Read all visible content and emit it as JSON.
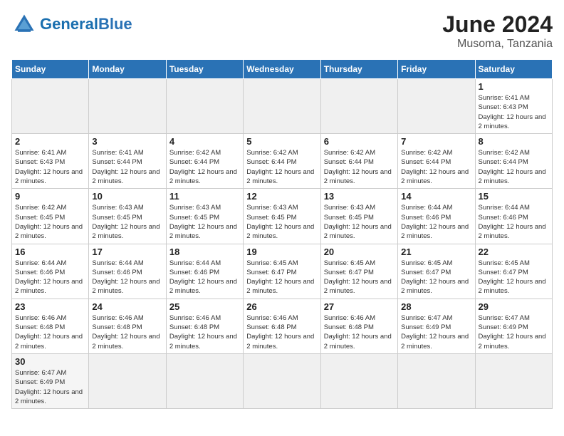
{
  "header": {
    "logo_text_normal": "General",
    "logo_text_blue": "Blue",
    "title": "June 2024",
    "subtitle": "Musoma, Tanzania"
  },
  "calendar": {
    "days_of_week": [
      "Sunday",
      "Monday",
      "Tuesday",
      "Wednesday",
      "Thursday",
      "Friday",
      "Saturday"
    ],
    "weeks": [
      [
        {
          "day": "",
          "info": "",
          "empty": true
        },
        {
          "day": "",
          "info": "",
          "empty": true
        },
        {
          "day": "",
          "info": "",
          "empty": true
        },
        {
          "day": "",
          "info": "",
          "empty": true
        },
        {
          "day": "",
          "info": "",
          "empty": true
        },
        {
          "day": "",
          "info": "",
          "empty": true
        },
        {
          "day": "1",
          "info": "Sunrise: 6:41 AM\nSunset: 6:43 PM\nDaylight: 12 hours and 2 minutes."
        }
      ],
      [
        {
          "day": "2",
          "info": "Sunrise: 6:41 AM\nSunset: 6:43 PM\nDaylight: 12 hours and 2 minutes."
        },
        {
          "day": "3",
          "info": "Sunrise: 6:41 AM\nSunset: 6:44 PM\nDaylight: 12 hours and 2 minutes."
        },
        {
          "day": "4",
          "info": "Sunrise: 6:42 AM\nSunset: 6:44 PM\nDaylight: 12 hours and 2 minutes."
        },
        {
          "day": "5",
          "info": "Sunrise: 6:42 AM\nSunset: 6:44 PM\nDaylight: 12 hours and 2 minutes."
        },
        {
          "day": "6",
          "info": "Sunrise: 6:42 AM\nSunset: 6:44 PM\nDaylight: 12 hours and 2 minutes."
        },
        {
          "day": "7",
          "info": "Sunrise: 6:42 AM\nSunset: 6:44 PM\nDaylight: 12 hours and 2 minutes."
        },
        {
          "day": "8",
          "info": "Sunrise: 6:42 AM\nSunset: 6:44 PM\nDaylight: 12 hours and 2 minutes."
        }
      ],
      [
        {
          "day": "9",
          "info": "Sunrise: 6:42 AM\nSunset: 6:45 PM\nDaylight: 12 hours and 2 minutes."
        },
        {
          "day": "10",
          "info": "Sunrise: 6:43 AM\nSunset: 6:45 PM\nDaylight: 12 hours and 2 minutes."
        },
        {
          "day": "11",
          "info": "Sunrise: 6:43 AM\nSunset: 6:45 PM\nDaylight: 12 hours and 2 minutes."
        },
        {
          "day": "12",
          "info": "Sunrise: 6:43 AM\nSunset: 6:45 PM\nDaylight: 12 hours and 2 minutes."
        },
        {
          "day": "13",
          "info": "Sunrise: 6:43 AM\nSunset: 6:45 PM\nDaylight: 12 hours and 2 minutes."
        },
        {
          "day": "14",
          "info": "Sunrise: 6:44 AM\nSunset: 6:46 PM\nDaylight: 12 hours and 2 minutes."
        },
        {
          "day": "15",
          "info": "Sunrise: 6:44 AM\nSunset: 6:46 PM\nDaylight: 12 hours and 2 minutes."
        }
      ],
      [
        {
          "day": "16",
          "info": "Sunrise: 6:44 AM\nSunset: 6:46 PM\nDaylight: 12 hours and 2 minutes."
        },
        {
          "day": "17",
          "info": "Sunrise: 6:44 AM\nSunset: 6:46 PM\nDaylight: 12 hours and 2 minutes."
        },
        {
          "day": "18",
          "info": "Sunrise: 6:44 AM\nSunset: 6:46 PM\nDaylight: 12 hours and 2 minutes."
        },
        {
          "day": "19",
          "info": "Sunrise: 6:45 AM\nSunset: 6:47 PM\nDaylight: 12 hours and 2 minutes."
        },
        {
          "day": "20",
          "info": "Sunrise: 6:45 AM\nSunset: 6:47 PM\nDaylight: 12 hours and 2 minutes."
        },
        {
          "day": "21",
          "info": "Sunrise: 6:45 AM\nSunset: 6:47 PM\nDaylight: 12 hours and 2 minutes."
        },
        {
          "day": "22",
          "info": "Sunrise: 6:45 AM\nSunset: 6:47 PM\nDaylight: 12 hours and 2 minutes."
        }
      ],
      [
        {
          "day": "23",
          "info": "Sunrise: 6:46 AM\nSunset: 6:48 PM\nDaylight: 12 hours and 2 minutes."
        },
        {
          "day": "24",
          "info": "Sunrise: 6:46 AM\nSunset: 6:48 PM\nDaylight: 12 hours and 2 minutes."
        },
        {
          "day": "25",
          "info": "Sunrise: 6:46 AM\nSunset: 6:48 PM\nDaylight: 12 hours and 2 minutes."
        },
        {
          "day": "26",
          "info": "Sunrise: 6:46 AM\nSunset: 6:48 PM\nDaylight: 12 hours and 2 minutes."
        },
        {
          "day": "27",
          "info": "Sunrise: 6:46 AM\nSunset: 6:48 PM\nDaylight: 12 hours and 2 minutes."
        },
        {
          "day": "28",
          "info": "Sunrise: 6:47 AM\nSunset: 6:49 PM\nDaylight: 12 hours and 2 minutes."
        },
        {
          "day": "29",
          "info": "Sunrise: 6:47 AM\nSunset: 6:49 PM\nDaylight: 12 hours and 2 minutes."
        }
      ],
      [
        {
          "day": "30",
          "info": "Sunrise: 6:47 AM\nSunset: 6:49 PM\nDaylight: 12 hours and 2 minutes.",
          "last": true
        },
        {
          "day": "",
          "info": "",
          "empty": true,
          "last": true
        },
        {
          "day": "",
          "info": "",
          "empty": true,
          "last": true
        },
        {
          "day": "",
          "info": "",
          "empty": true,
          "last": true
        },
        {
          "day": "",
          "info": "",
          "empty": true,
          "last": true
        },
        {
          "day": "",
          "info": "",
          "empty": true,
          "last": true
        },
        {
          "day": "",
          "info": "",
          "empty": true,
          "last": true
        }
      ]
    ]
  }
}
